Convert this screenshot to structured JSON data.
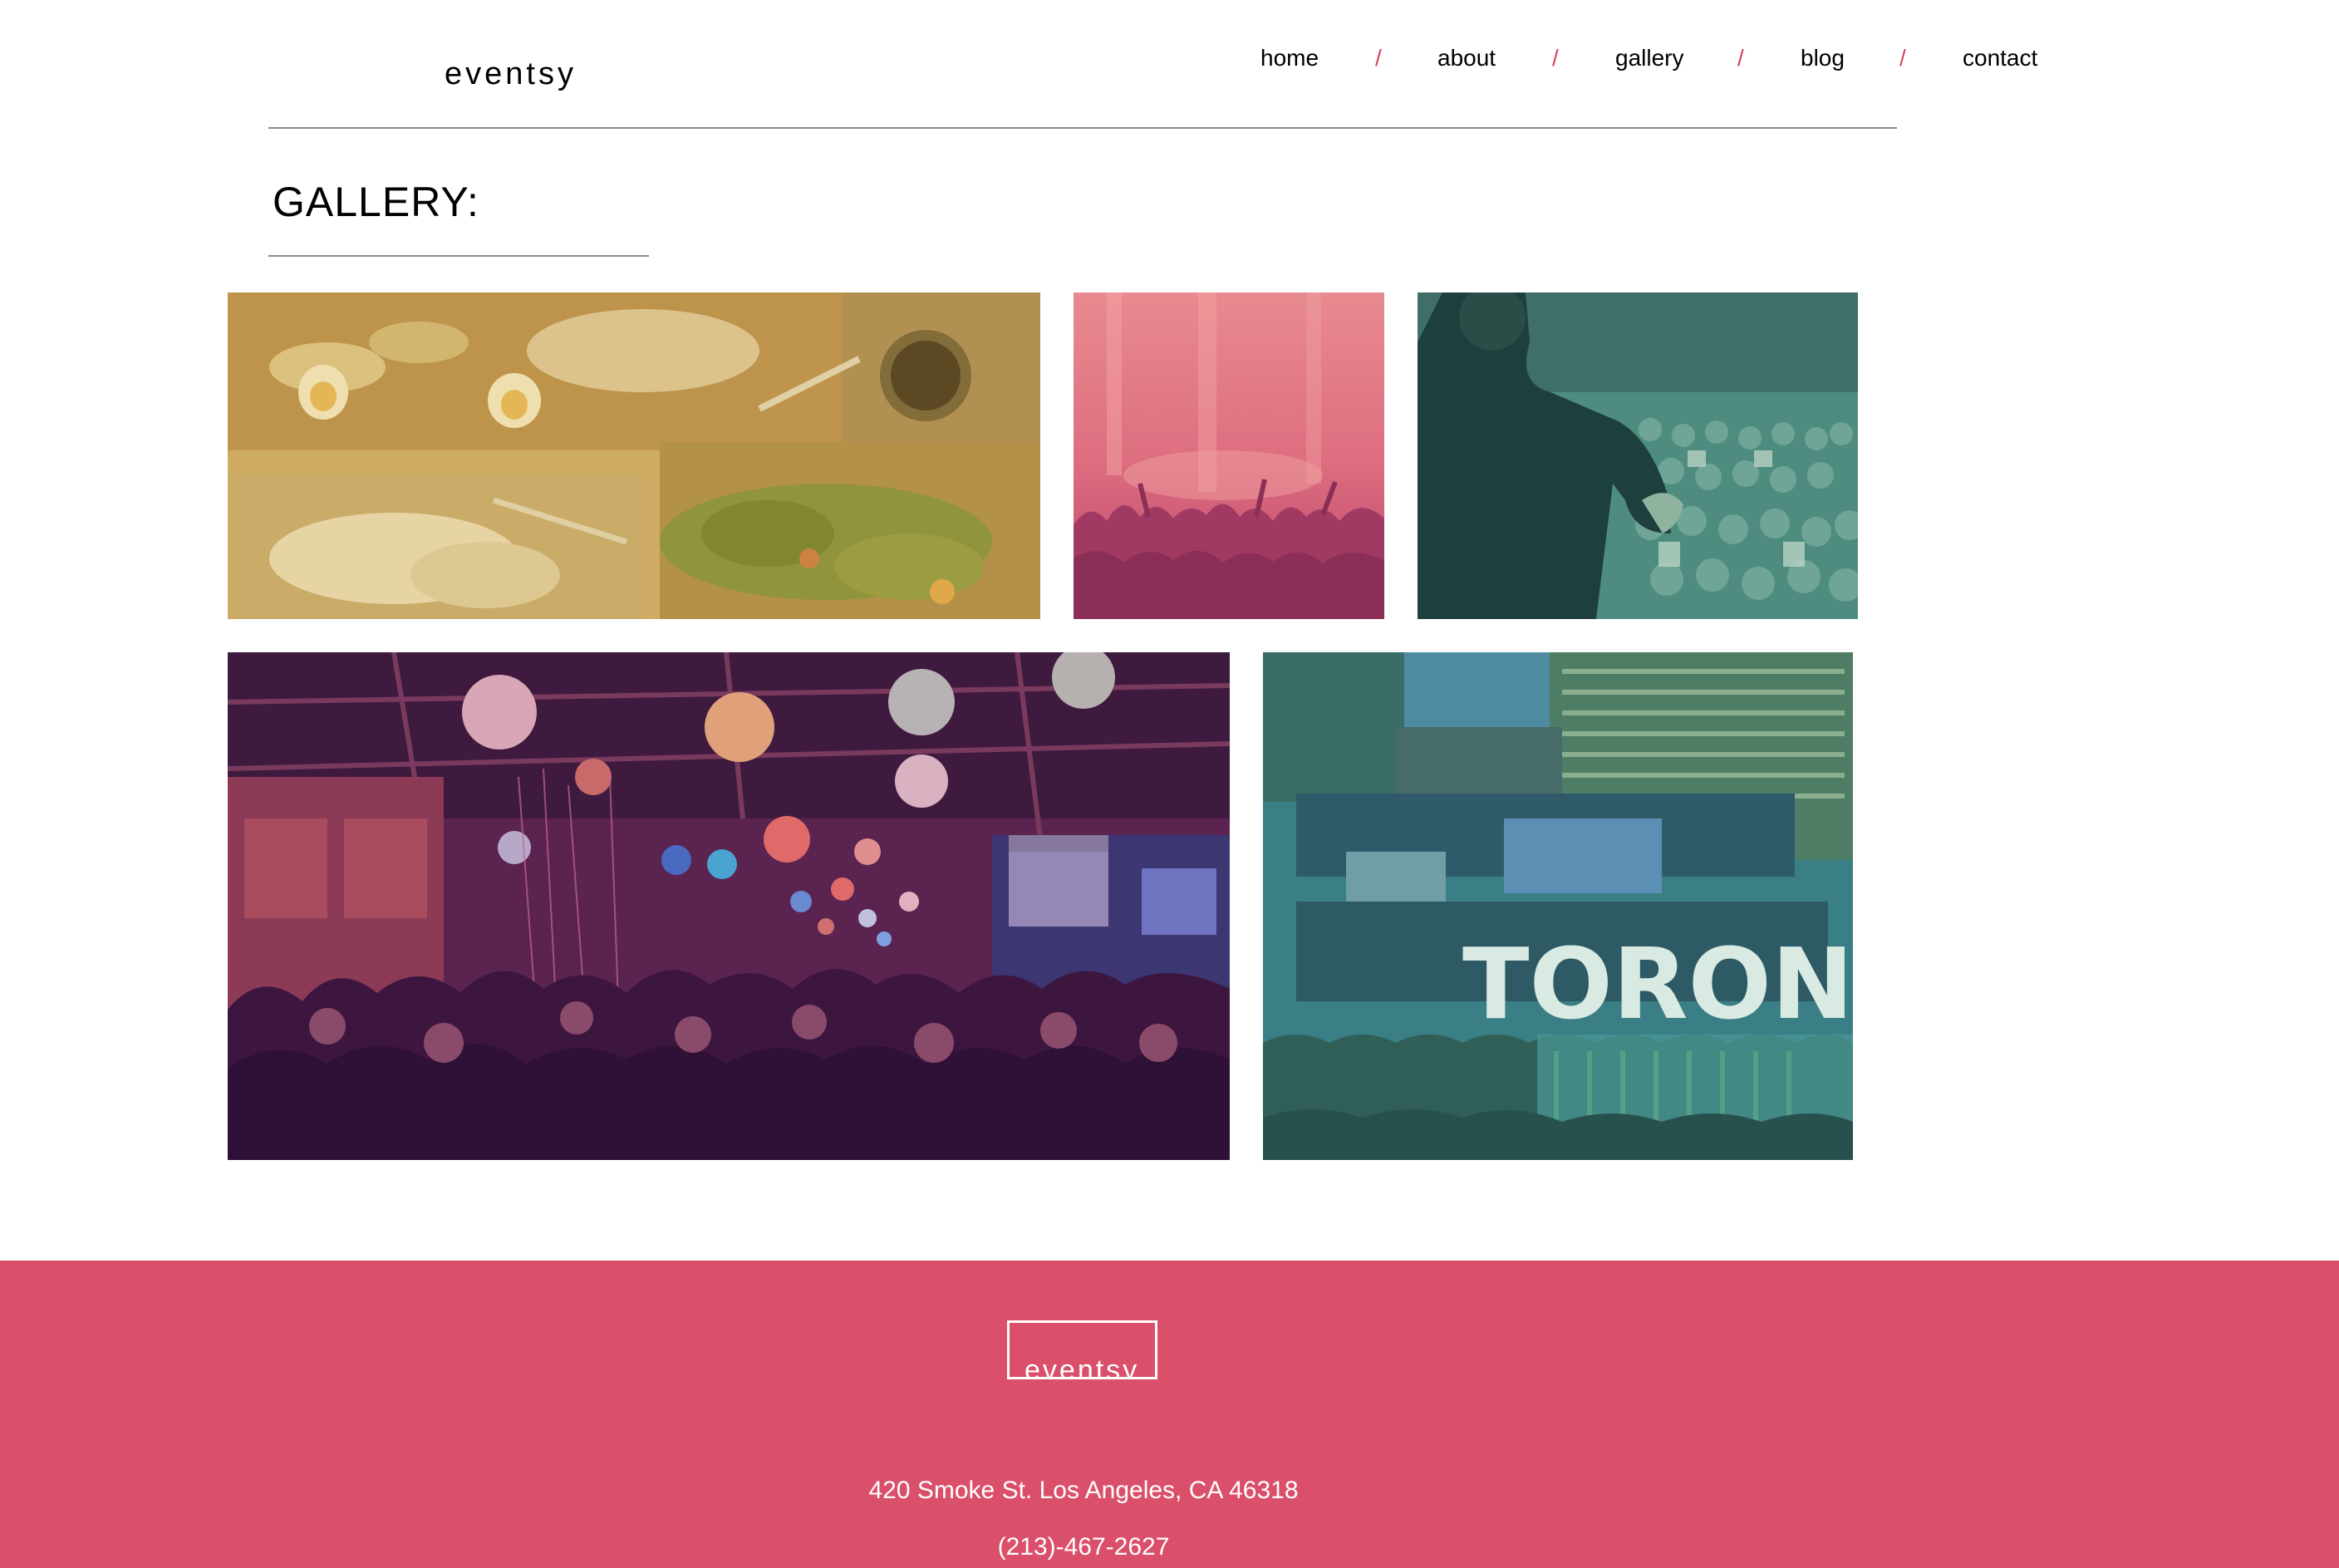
{
  "header": {
    "logo": "eventsy",
    "nav": [
      {
        "label": "home"
      },
      {
        "label": "about"
      },
      {
        "label": "gallery"
      },
      {
        "label": "blog"
      },
      {
        "label": "contact"
      }
    ],
    "separator": "/"
  },
  "gallery": {
    "title": "GALLERY:"
  },
  "photos": [
    {
      "subject": "food platters on wooden boards"
    },
    {
      "subject": "concert crowd on pink stage"
    },
    {
      "subject": "speaker presenting to audience"
    },
    {
      "subject": "crowded festive dining hall with lanterns"
    },
    {
      "subject": "TORONTO sign at night festival",
      "sign_text": "TORONTO"
    }
  ],
  "footer": {
    "logo": "eventsy",
    "address": "420 Smoke St. Los Angeles, CA 46318",
    "phone": "(213)-467-2627"
  },
  "colors": {
    "accent": "#da4f6a",
    "separator": "#d6435f",
    "rule": "#8a8a8a"
  }
}
